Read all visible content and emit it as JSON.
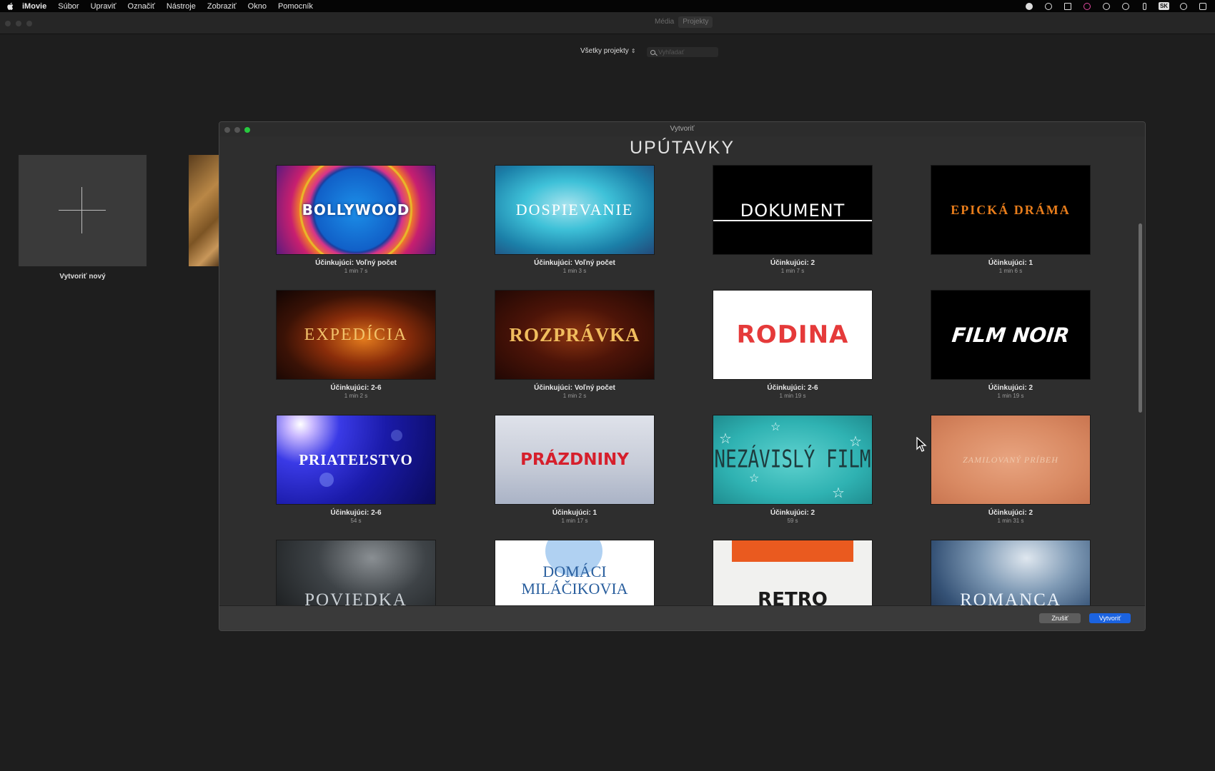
{
  "menubar": {
    "app": "iMovie",
    "items": [
      "Súbor",
      "Upraviť",
      "Označiť",
      "Nástroje",
      "Zobraziť",
      "Okno",
      "Pomocník"
    ],
    "keyboard": "SK"
  },
  "toolbar": {
    "tabs": [
      "Média",
      "Projekty"
    ],
    "selected_tab": "Projekty",
    "filter_label": "Všetky projekty",
    "search_placeholder": "Vyhľadať"
  },
  "background": {
    "new_project_label": "Vytvoriť nový"
  },
  "dialog": {
    "window_title": "Vytvoriť",
    "heading": "UPÚTAVKY",
    "trailers": [
      {
        "title": "BOLLYWOOD",
        "cast": "Účinkujúci: Voľný počet",
        "duration": "1 min 7 s"
      },
      {
        "title": "DOSPIEVANIE",
        "cast": "Účinkujúci: Voľný počet",
        "duration": "1 min 3 s"
      },
      {
        "title": "DOKUMENT",
        "cast": "Účinkujúci: 2",
        "duration": "1 min 7 s"
      },
      {
        "title": "EPICKÁ DRÁMA",
        "cast": "Účinkujúci: 1",
        "duration": "1 min 6 s"
      },
      {
        "title": "EXPEDÍCIA",
        "cast": "Účinkujúci: 2-6",
        "duration": "1 min 2 s"
      },
      {
        "title": "ROZPRÁVKA",
        "cast": "Účinkujúci: Voľný počet",
        "duration": "1 min 2 s"
      },
      {
        "title": "RODINA",
        "cast": "Účinkujúci: 2-6",
        "duration": "1 min 19 s"
      },
      {
        "title": "FILM NOIR",
        "cast": "Účinkujúci: 2",
        "duration": "1 min 19 s"
      },
      {
        "title": "PRIATEĽSTVO",
        "cast": "Účinkujúci: 2-6",
        "duration": "54 s"
      },
      {
        "title": "PRÁZDNINY",
        "cast": "Účinkujúci: 1",
        "duration": "1 min 17 s"
      },
      {
        "title": "NEZÁVISLÝ FILM",
        "cast": "Účinkujúci: 2",
        "duration": "59 s"
      },
      {
        "title": "ZAMILOVANÝ PRÍBEH",
        "cast": "Účinkujúci: 2",
        "duration": "1 min 31 s"
      },
      {
        "title": "POVIEDKA",
        "cast": "",
        "duration": ""
      },
      {
        "title": "DOMÁCI MILÁČIKOVIA",
        "cast": "",
        "duration": ""
      },
      {
        "title": "RETRO",
        "cast": "",
        "duration": ""
      },
      {
        "title": "ROMANCA",
        "cast": "",
        "duration": ""
      }
    ],
    "cancel_label": "Zrušiť",
    "create_label": "Vytvoriť"
  },
  "colors": {
    "accent_button": "#1b63e0",
    "traffic_green": "#27c93f"
  }
}
